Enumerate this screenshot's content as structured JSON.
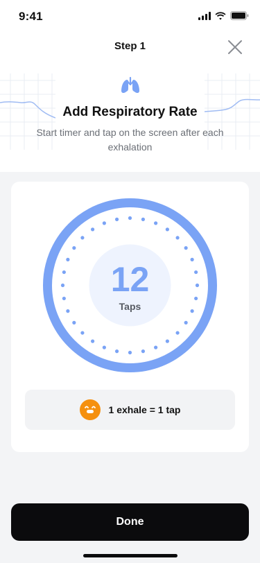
{
  "status_bar": {
    "time": "9:41"
  },
  "header": {
    "step_title": "Step 1",
    "title": "Add Respiratory Rate",
    "subtitle": "Start timer and tap on the screen after each exhalation"
  },
  "timer": {
    "count": "12",
    "label": "Taps"
  },
  "hint": {
    "text": "1 exhale = 1 tap"
  },
  "done_button": {
    "label": "Done"
  },
  "colors": {
    "accent_blue": "#7aa3f5",
    "hint_icon_orange": "#f5900f",
    "button_dark": "#0b0b0d"
  },
  "icons": [
    "signal-icon",
    "wifi-icon",
    "battery-icon",
    "close-icon",
    "lungs-icon",
    "exhale-face-icon"
  ]
}
